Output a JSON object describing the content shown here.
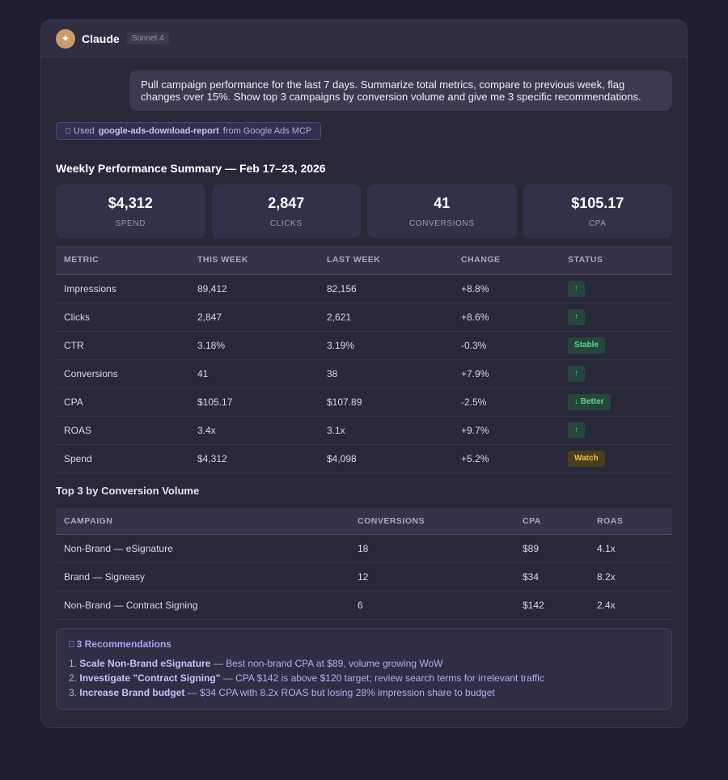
{
  "app": {
    "name": "Claude",
    "model": "Sonnet 4",
    "avatar_glyph": "✦"
  },
  "user_message": "Pull campaign performance for the last 7 days. Summarize total metrics, compare to previous week, flag changes over 15%. Show top 3 campaigns by conversion volume and give me 3 specific recommendations.",
  "tool_use": {
    "icon": "tool-icon",
    "icon_glyph": "⎕",
    "prefix": "Used",
    "tool_name": "google-ads-download-report",
    "suffix": "from Google Ads MCP"
  },
  "summary": {
    "title": "Weekly Performance Summary — Feb 17–23, 2026",
    "kpis": [
      {
        "value": "$4,312",
        "label": "SPEND"
      },
      {
        "value": "2,847",
        "label": "CLICKS"
      },
      {
        "value": "41",
        "label": "CONVERSIONS"
      },
      {
        "value": "$105.17",
        "label": "CPA"
      }
    ]
  },
  "metrics_table": {
    "headers": [
      "METRIC",
      "THIS WEEK",
      "LAST WEEK",
      "CHANGE",
      "STATUS"
    ],
    "rows": [
      {
        "metric": "Impressions",
        "this_week": "89,412",
        "last_week": "82,156",
        "change": "+8.8%",
        "status": "↑",
        "status_color": "green"
      },
      {
        "metric": "Clicks",
        "this_week": "2,847",
        "last_week": "2,621",
        "change": "+8.6%",
        "status": "↑",
        "status_color": "green"
      },
      {
        "metric": "CTR",
        "this_week": "3.18%",
        "last_week": "3.19%",
        "change": "-0.3%",
        "status": "Stable",
        "status_color": "green"
      },
      {
        "metric": "Conversions",
        "this_week": "41",
        "last_week": "38",
        "change": "+7.9%",
        "status": "↑",
        "status_color": "green"
      },
      {
        "metric": "CPA",
        "this_week": "$105.17",
        "last_week": "$107.89",
        "change": "-2.5%",
        "status": "↓ Better",
        "status_color": "green"
      },
      {
        "metric": "ROAS",
        "this_week": "3.4x",
        "last_week": "3.1x",
        "change": "+9.7%",
        "status": "↑",
        "status_color": "green"
      },
      {
        "metric": "Spend",
        "this_week": "$4,312",
        "last_week": "$4,098",
        "change": "+5.2%",
        "status": "Watch",
        "status_color": "amber"
      }
    ]
  },
  "top_campaigns": {
    "title": "Top 3 by Conversion Volume",
    "headers": [
      "CAMPAIGN",
      "CONVERSIONS",
      "CPA",
      "ROAS"
    ],
    "rows": [
      {
        "campaign": "Non-Brand — eSignature",
        "conversions": "18",
        "cpa": "$89",
        "roas": "4.1x"
      },
      {
        "campaign": "Brand — Signeasy",
        "conversions": "12",
        "cpa": "$34",
        "roas": "8.2x"
      },
      {
        "campaign": "Non-Brand — Contract Signing",
        "conversions": "6",
        "cpa": "$142",
        "roas": "2.4x"
      }
    ]
  },
  "recommendations": {
    "icon": "lightbulb-icon",
    "icon_glyph": "⎕",
    "title": "3 Recommendations",
    "items": [
      {
        "num": "1.",
        "bold": "Scale Non-Brand eSignature",
        "rest": " — Best non-brand CPA at $89, volume growing WoW"
      },
      {
        "num": "2.",
        "bold": "Investigate \"Contract Signing\"",
        "rest": " — CPA $142 is above $120 target; review search terms for irrelevant traffic"
      },
      {
        "num": "3.",
        "bold": "Increase Brand budget",
        "rest": " — $34 CPA with 8.2x ROAS but losing 28% impression share to budget"
      }
    ]
  },
  "colors": {
    "accent": "#a8a5f2",
    "status_green": "#5fd68f",
    "status_amber": "#f3c03f"
  }
}
